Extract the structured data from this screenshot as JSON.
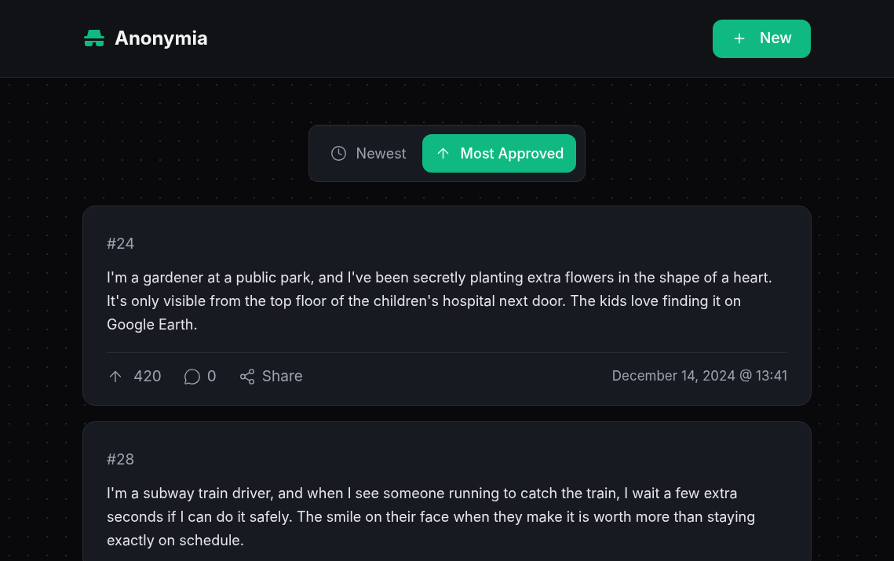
{
  "header": {
    "brand": "Anonymia",
    "new_button": "New"
  },
  "sort_tabs": [
    {
      "label": "Newest",
      "kind": "clock",
      "selected": false
    },
    {
      "label": "Most Approved",
      "kind": "arrow",
      "selected": true
    }
  ],
  "posts": [
    {
      "id": "#24",
      "text": "I'm a gardener at a public park, and I've been secretly planting extra flowers in the shape of a heart. It's only visible from the top floor of the children's hospital next door. The kids love finding it on Google Earth.",
      "approvals": "420",
      "comments": "0",
      "share": "Share",
      "date": "December 14, 2024 @ 13:41"
    },
    {
      "id": "#28",
      "text": "I'm a subway train driver, and when I see someone running to catch the train, I wait a few extra seconds if I can do it safely. The smile on their face when they make it is worth more than staying exactly on schedule."
    }
  ]
}
